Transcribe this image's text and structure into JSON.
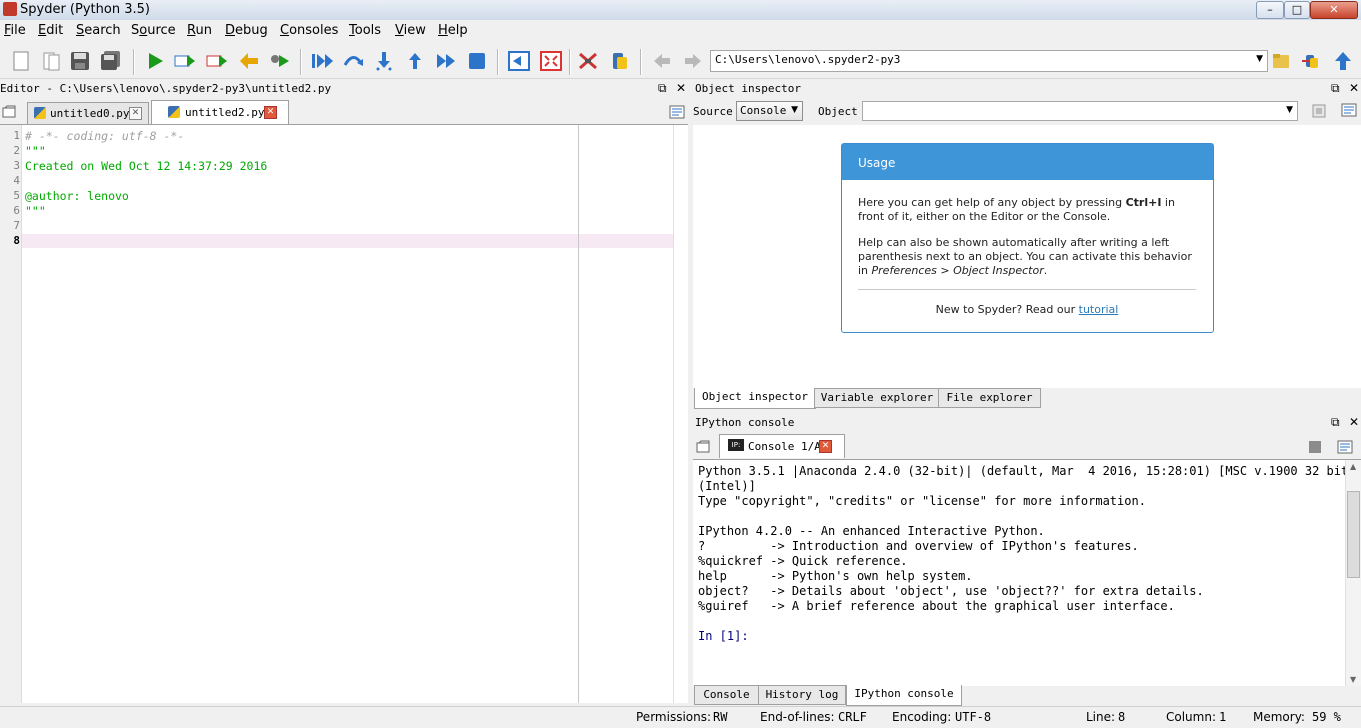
{
  "window": {
    "title": "Spyder (Python 3.5)",
    "controls": [
      "minimize",
      "maximize",
      "close"
    ]
  },
  "menubar": {
    "items": [
      {
        "label": "File",
        "u": "F"
      },
      {
        "label": "Edit",
        "u": "E"
      },
      {
        "label": "Search",
        "u": "S"
      },
      {
        "label": "Source",
        "u": "o"
      },
      {
        "label": "Run",
        "u": "R"
      },
      {
        "label": "Debug",
        "u": "D"
      },
      {
        "label": "Consoles",
        "u": "C"
      },
      {
        "label": "Tools",
        "u": "T"
      },
      {
        "label": "View",
        "u": "V"
      },
      {
        "label": "Help",
        "u": "H"
      }
    ]
  },
  "toolbar": {
    "path": "C:\\Users\\lenovo\\.spyder2-py3",
    "icons": [
      "new-file",
      "open-file",
      "save-file",
      "save-all",
      "run",
      "run-cell",
      "run-cell-advance",
      "run-selection",
      "debug",
      "debug-step",
      "step-over",
      "step-into",
      "step-return",
      "continue",
      "stop",
      "maximize-pane",
      "fullscreen",
      "preferences",
      "python-path",
      "back",
      "forward",
      "browse",
      "set-working-dir",
      "parent-dir"
    ]
  },
  "editor": {
    "header": "Editor - C:\\Users\\lenovo\\.spyder2-py3\\untitled2.py",
    "tabs": [
      {
        "label": "untitled0.py",
        "active": false
      },
      {
        "label": "untitled2.py",
        "active": true
      }
    ],
    "lines": [
      {
        "num": "1",
        "text": "# -*- coding: utf-8 -*-",
        "style": "comment"
      },
      {
        "num": "2",
        "text": "\"\"\"",
        "style": "string"
      },
      {
        "num": "3",
        "text": "Created on Wed Oct 12 14:37:29 2016",
        "style": "string"
      },
      {
        "num": "4",
        "text": "",
        "style": "string"
      },
      {
        "num": "5",
        "text": "@author: lenovo",
        "style": "string"
      },
      {
        "num": "6",
        "text": "\"\"\"",
        "style": "string"
      },
      {
        "num": "7",
        "text": "",
        "style": "plain"
      },
      {
        "num": "8",
        "text": "",
        "style": "plain"
      }
    ],
    "current_line": "8"
  },
  "object_inspector": {
    "header": "Object inspector",
    "source_label": "Source",
    "source_value": "Console",
    "object_label": "Object",
    "object_value": "",
    "usage": {
      "title": "Usage",
      "p1_pre": "Here you can get help of any object by pressing ",
      "p1_bold": "Ctrl+I",
      "p1_post": " in front of it, either on the Editor or the Console.",
      "p2_pre": "Help can also be shown automatically after writing a left parenthesis next to an object. You can activate this behavior in ",
      "p2_italic": "Preferences > Object Inspector",
      "p2_post": ".",
      "new_pre": "New to Spyder? Read our ",
      "new_link": "tutorial"
    },
    "tabs": [
      {
        "label": "Object inspector",
        "active": true
      },
      {
        "label": "Variable explorer",
        "active": false
      },
      {
        "label": "File explorer",
        "active": false
      }
    ]
  },
  "ipython": {
    "header": "IPython console",
    "tab_label": "Console 1/A",
    "tab_badge": "IP:",
    "lines": [
      "Python 3.5.1 |Anaconda 2.4.0 (32-bit)| (default, Mar  4 2016, 15:28:01) [MSC v.1900 32 bit",
      "(Intel)]",
      "Type \"copyright\", \"credits\" or \"license\" for more information.",
      "",
      "IPython 4.2.0 -- An enhanced Interactive Python.",
      "?         -> Introduction and overview of IPython's features.",
      "%quickref -> Quick reference.",
      "help      -> Python's own help system.",
      "object?   -> Details about 'object', use 'object??' for extra details.",
      "%guiref   -> A brief reference about the graphical user interface.",
      ""
    ],
    "prompt": "In [1]:",
    "tabs": [
      {
        "label": "Console",
        "active": false
      },
      {
        "label": "History log",
        "active": false
      },
      {
        "label": "IPython console",
        "active": true
      }
    ]
  },
  "status": {
    "permissions_label": "Permissions:",
    "permissions_value": "RW",
    "eol_label": "End-of-lines:",
    "eol_value": "CRLF",
    "encoding_label": "Encoding:",
    "encoding_value": "UTF-8",
    "line_label": "Line:",
    "line_value": "8",
    "column_label": "Column:",
    "column_value": "1",
    "memory_label": "Memory:",
    "memory_value": "59 %"
  },
  "colors": {
    "comment": "#a0a0a0",
    "string": "#00aa00",
    "prompt": "#000080",
    "accent": "#3e96d8",
    "current_line": "#f7e9f3"
  }
}
